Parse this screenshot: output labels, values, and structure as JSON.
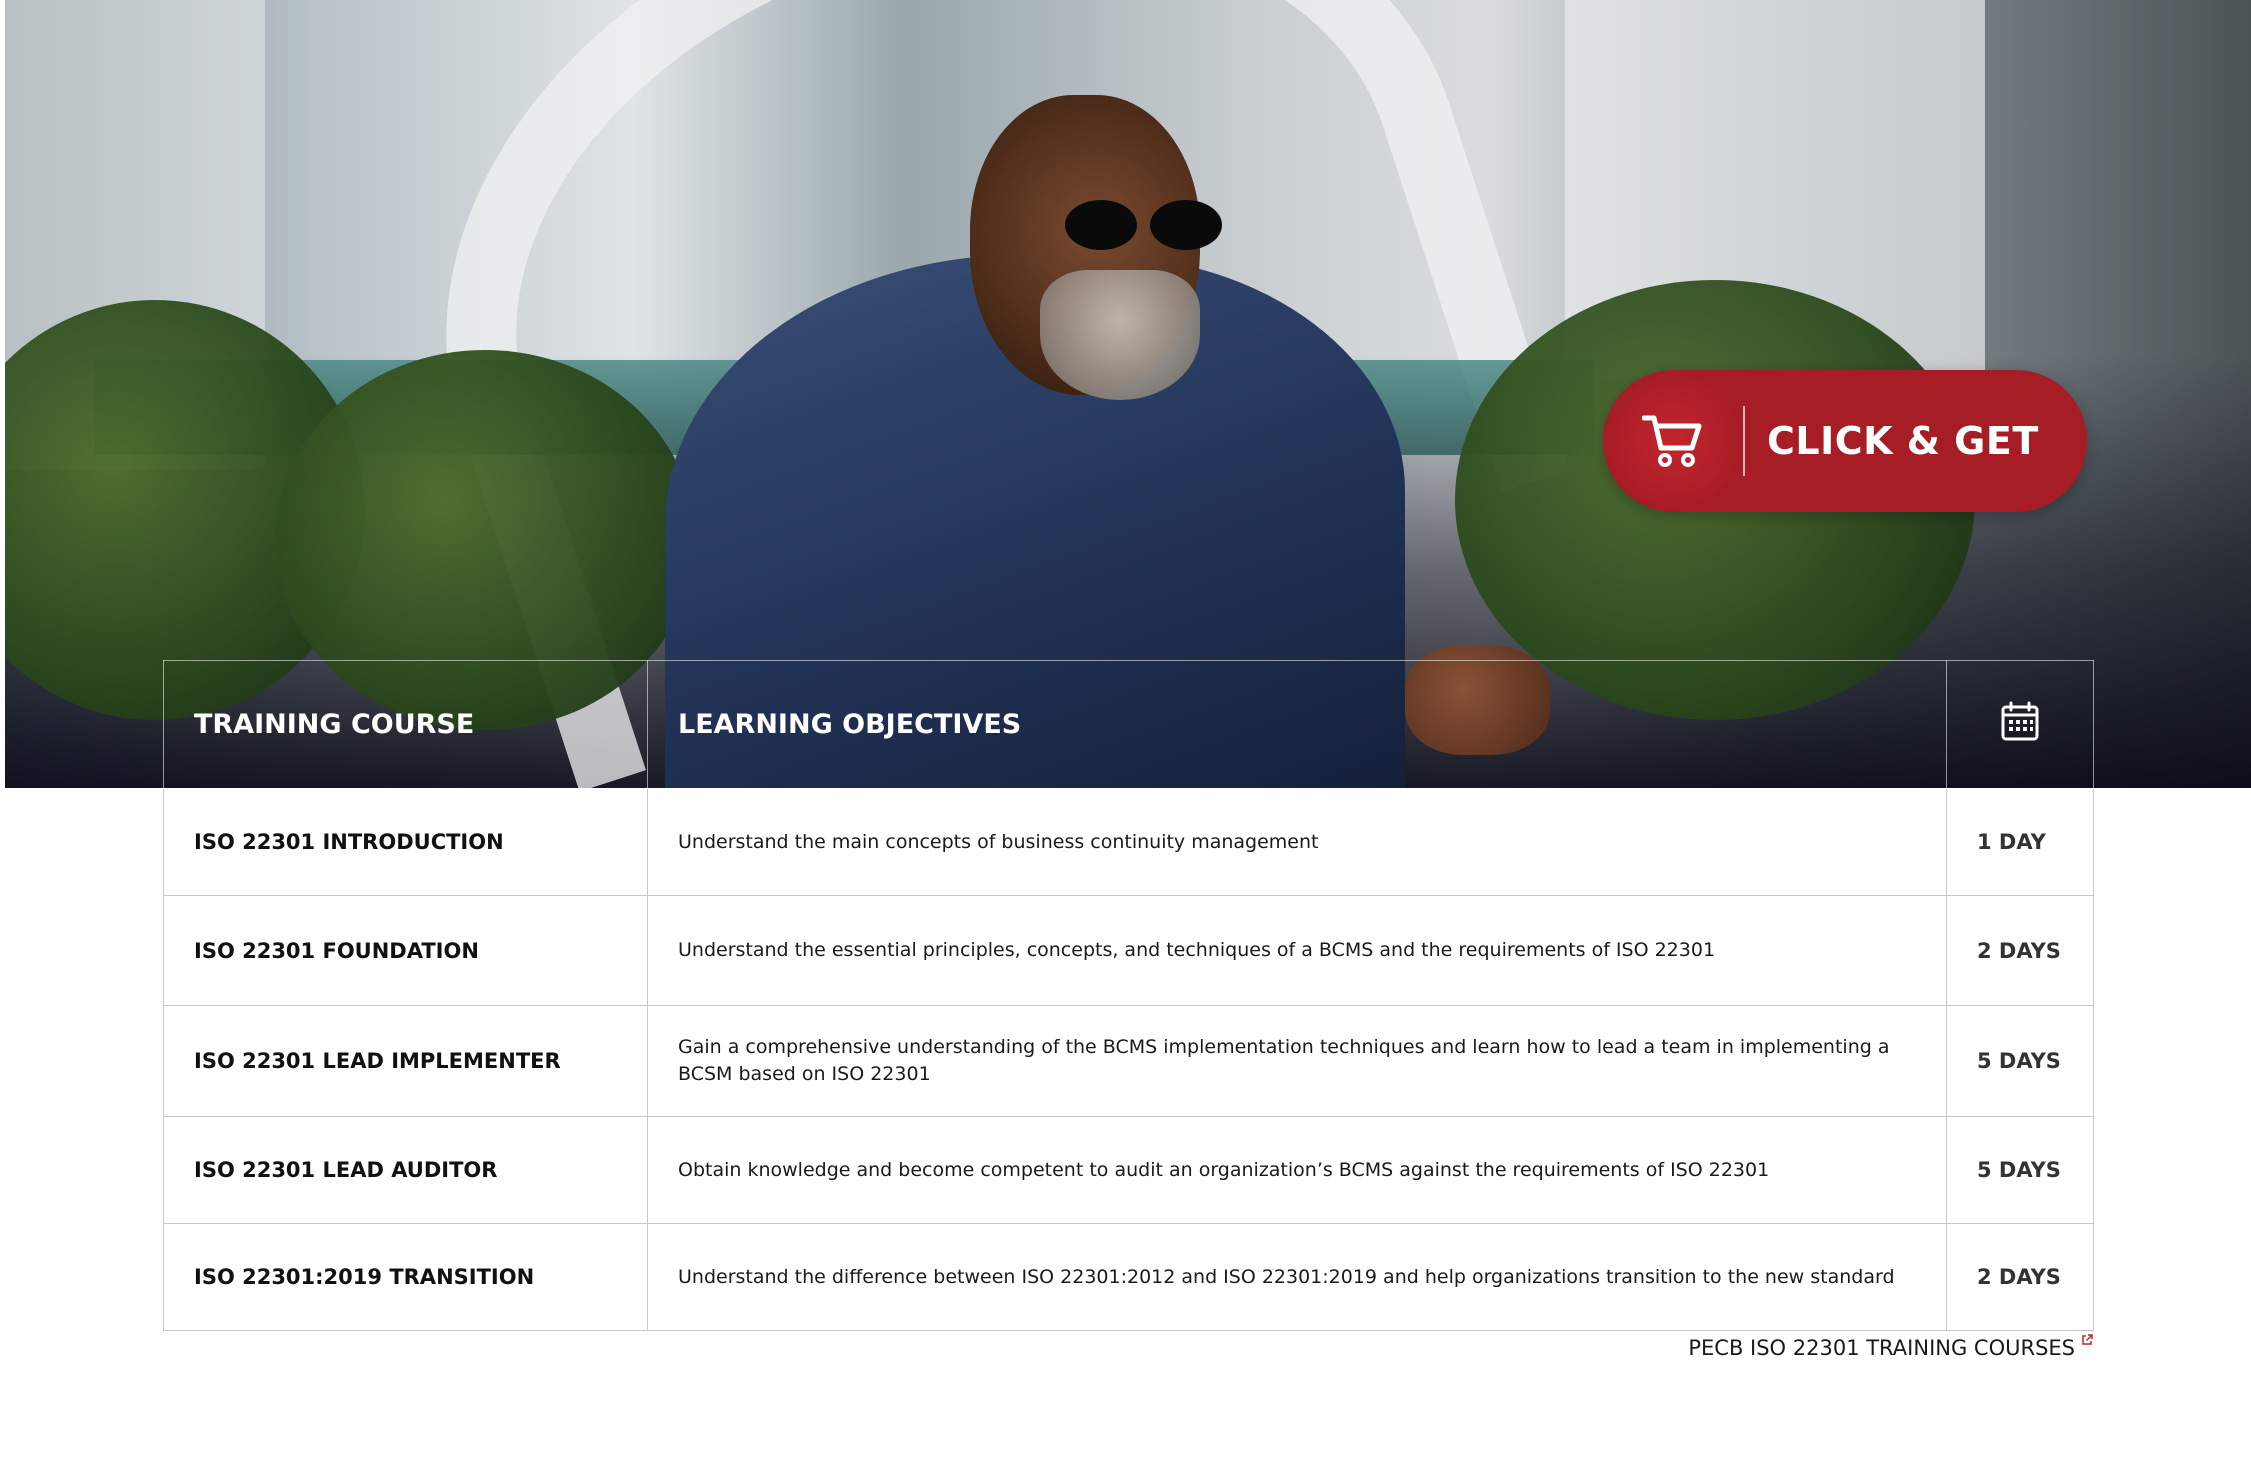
{
  "cta": {
    "label": "CLICK & GET",
    "icon": "shopping-cart-icon",
    "color": "#a71d25"
  },
  "table": {
    "headers": {
      "course": "TRAINING COURSE",
      "objectives": "LEARNING OBJECTIVES",
      "duration_icon": "calendar-icon"
    },
    "rows": [
      {
        "course": "ISO 22301 INTRODUCTION",
        "objective": "Understand the main concepts of business continuity management",
        "duration": "1 DAY"
      },
      {
        "course": "ISO 22301 FOUNDATION",
        "objective": "Understand the essential principles, concepts, and techniques of a BCMS and the requirements of ISO 22301",
        "duration": "2 DAYS"
      },
      {
        "course": "ISO 22301 LEAD IMPLEMENTER",
        "objective": "Gain a comprehensive understanding of the BCMS implementation techniques and learn how to lead a team in implementing a BCSM based on ISO 22301",
        "duration": "5 DAYS"
      },
      {
        "course": "ISO 22301 LEAD AUDITOR",
        "objective": "Obtain knowledge and become competent to audit an organization’s BCMS against the requirements of ISO 22301",
        "duration": "5 DAYS"
      },
      {
        "course": "ISO 22301:2019 TRANSITION",
        "objective": "Understand the difference between ISO 22301:2012 and ISO 22301:2019 and help organizations transition to the new standard",
        "duration": "2 DAYS"
      }
    ]
  },
  "footer_link": {
    "label": "PECB ISO 22301 TRAINING COURSES",
    "icon": "external-link-icon",
    "icon_color": "#c0272d"
  }
}
